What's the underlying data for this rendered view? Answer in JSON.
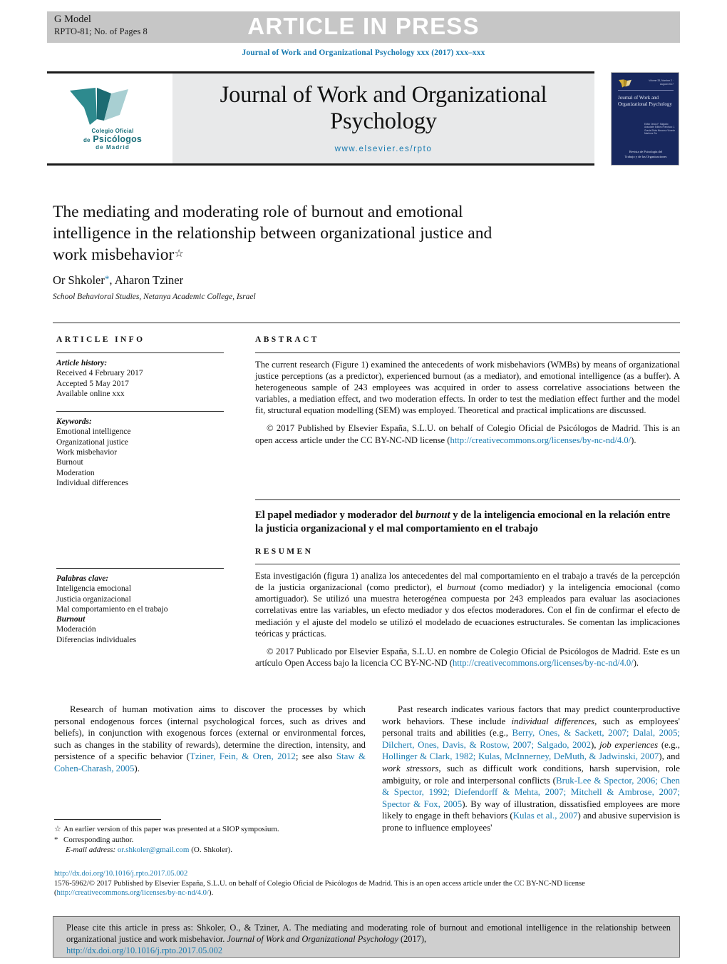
{
  "header": {
    "g_model": "G Model",
    "article_id": "RPTO-81;   No. of Pages 8",
    "article_in_press": "ARTICLE IN PRESS",
    "journal_ref": "Journal of Work and Organizational Psychology xxx (2017) xxx–xxx"
  },
  "masthead": {
    "journal_title": "Journal of Work and Organizational Psychology",
    "website": "www.elsevier.es/rpto",
    "logo": {
      "line1": "Colegio Oficial",
      "line2_prefix": "de",
      "line2": "Psicólogos",
      "line3": "de Madrid"
    },
    "cover": {
      "issue": "Volume 33, Number 2 · August 2017",
      "title": "Journal of Work and Organizational Psychology",
      "editors": "Editor Jesús F. Salgado Associate Editors Francisco J. Gracia Silvia Moscoso Vicente Martínez-Tur",
      "footer_line1": "Revista de Psicología del",
      "footer_line2": "Trabajo y de las Organizaciones"
    }
  },
  "article": {
    "title": "The mediating and moderating role of burnout and emotional intelligence in the relationship between organizational justice and work misbehavior",
    "title_marker": "☆",
    "authors": "Or Shkoler",
    "authors_marker": "*",
    "authors_rest": ", Aharon Tziner",
    "affiliation": "School Behavioral Studies, Netanya Academic College, Israel"
  },
  "info": {
    "heading": "ARTICLE INFO",
    "history_label": "Article history:",
    "history": [
      "Received 4 February 2017",
      "Accepted 5 May 2017",
      "Available online xxx"
    ],
    "keywords_label": "Keywords:",
    "keywords": [
      "Emotional intelligence",
      "Organizational justice",
      "Work misbehavior",
      "Burnout",
      "Moderation",
      "Individual differences"
    ],
    "palabras_label": "Palabras clave:",
    "palabras": [
      "Inteligencia emocional",
      "Justicia organizacional",
      "Mal comportamiento en el trabajo",
      "Burnout",
      "Moderación",
      "Diferencias individuales"
    ]
  },
  "abstract": {
    "heading": "ABSTRACT",
    "body": "The current research (Figure 1) examined the antecedents of work misbehaviors (WMBs) by means of organizational justice perceptions (as a predictor), experienced burnout (as a mediator), and emotional intelligence (as a buffer). A heterogeneous sample of 243 employees was acquired in order to assess correlative associations between the variables, a mediation effect, and two moderation effects. In order to test the mediation effect further and the model fit, structural equation modelling (SEM) was employed. Theoretical and practical implications are discussed.",
    "copyright_pre": "© 2017 Published by Elsevier España, S.L.U. on behalf of Colegio Oficial de Psicólogos de Madrid. This is an open access article under the CC BY-NC-ND license (",
    "copyright_link": "http://creativecommons.org/licenses/by-nc-nd/4.0/",
    "copyright_post": ")."
  },
  "resumen": {
    "title": "El papel mediador y moderador del burnout y de la inteligencia emocional en la relación entre la justicia organizacional y el mal comportamiento en el trabajo",
    "title_part1": "El papel mediador y moderador del ",
    "title_italic": "burnout",
    "title_part2": " y de la inteligencia emocional en la relación entre la justicia organizacional y el mal comportamiento en el trabajo",
    "heading": "RESUMEN",
    "body_part1": "Esta investigación (figura 1) analiza los antecedentes del mal comportamiento en el trabajo a través de la percepción de la justicia organizacional (como predictor), el ",
    "body_italic": "burnout",
    "body_part2": " (como mediador) y la inteligencia emocional (como amortiguador). Se utilizó una muestra heterogénea compuesta por 243 empleados para evaluar las asociaciones correlativas entre las variables, un efecto mediador y dos efectos moderadores. Con el fin de confirmar el efecto de mediación y el ajuste del modelo se utilizó el modelado de ecuaciones estructurales. Se comentan las implicaciones teóricas y prácticas.",
    "copyright_pre": "© 2017 Publicado por Elsevier España, S.L.U. en nombre de Colegio Oficial de Psicólogos de Madrid. Este es un artículo Open Access bajo la licencia CC BY-NC-ND (",
    "copyright_link": "http://creativecommons.org/licenses/by-nc-nd/4.0/",
    "copyright_post": ")."
  },
  "body": {
    "left_paragraph": {
      "t1": "Research of human motivation aims to discover the processes by which personal endogenous forces (internal psychological forces, such as drives and beliefs), in conjunction with exogenous forces (external or environmental forces, such as changes in the stability of rewards), determine the direction, intensity, and persistence of a specific behavior (",
      "cite1": "Tziner, Fein, & Oren, 2012",
      "t2": "; see also ",
      "cite2": "Staw & Cohen-Charash, 2005",
      "t3": ")."
    },
    "right_paragraph": {
      "t1": "Past research indicates various factors that may predict counterproductive work behaviors. These include ",
      "it1": "individual differences",
      "t2": ", such as employees' personal traits and abilities (e.g., ",
      "cite1": "Berry, Ones, & Sackett, 2007; Dalal, 2005; Dilchert, Ones, Davis, & Rostow, 2007; Salgado, 2002",
      "t3": "), ",
      "it2": "job experiences",
      "t4": " (e.g., ",
      "cite2": "Hollinger & Clark, 1982; Kulas, McInnerney, DeMuth, & Jadwinski, 2007",
      "t5": "), and ",
      "it3": "work stressors",
      "t6": ", such as difficult work conditions, harsh supervision, role ambiguity, or role and interpersonal conflicts (",
      "cite3": "Bruk-Lee & Spector, 2006; Chen & Spector, 1992; Diefendorff & Mehta, 2007; Mitchell & Ambrose, 2007; Spector & Fox, 2005",
      "t7": "). By way of illustration, dissatisfied employees are more likely to engage in theft behaviors (",
      "cite4": "Kulas et al., 2007",
      "t8": ") and abusive supervision is prone to influence employees'"
    }
  },
  "footnotes": {
    "symposium_marker": "☆",
    "symposium": "An earlier version of this paper was presented at a SIOP symposium.",
    "corresponding_marker": "*",
    "corresponding": "Corresponding author.",
    "email_label": "E-mail address:",
    "email": "or.shkoler@gmail.com",
    "email_owner": "(O. Shkoler)."
  },
  "publisher_footer": {
    "doi": "http://dx.doi.org/10.1016/j.rpto.2017.05.002",
    "line_pre": "1576-5962/© 2017 Published by Elsevier España, S.L.U. on behalf of Colegio Oficial de Psicólogos de Madrid. This is an open access article under the CC BY-NC-ND license",
    "license_open": "(",
    "license_link": "http://creativecommons.org/licenses/by-nc-nd/4.0/",
    "license_close": ")."
  },
  "cite_box": {
    "text_pre": "Please cite this article in press as: Shkoler, O., & Tziner, A. The mediating and moderating role of burnout and emotional intelligence in the relationship between organizational justice and work misbehavior. ",
    "journal_italic": "Journal of Work and Organizational Psychology",
    "year": " (2017),",
    "doi": "http://dx.doi.org/10.1016/j.rpto.2017.05.002"
  },
  "colors": {
    "link_blue": "#1a7bb0",
    "band_gray": "#c6c6c6",
    "masthead_gray": "#e8e9ea",
    "cite_box_gray": "#cfcfcf",
    "cover_navy": "#18285e",
    "logo_teal": "#1a6f7a"
  }
}
